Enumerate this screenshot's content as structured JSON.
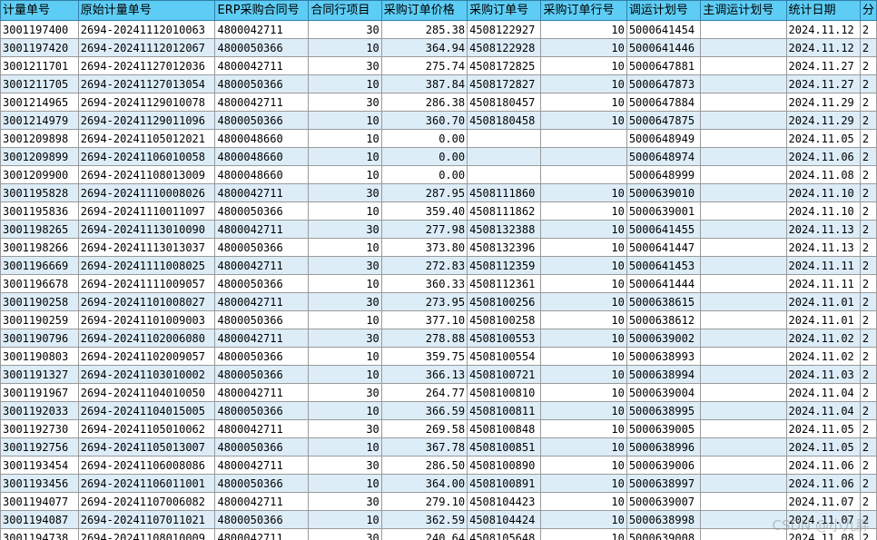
{
  "table": {
    "columns": [
      "计量单号",
      "原始计量单号",
      "ERP采购合同号",
      "合同行项目",
      "采购订单价格",
      "采购订单号",
      "采购订单行号",
      "调运计划号",
      "主调运计划号",
      "统计日期",
      "分"
    ],
    "rows": [
      [
        "3001197400",
        "2694-20241112010063",
        "4800042711",
        "30",
        "285.38",
        "4508122927",
        "10",
        "5000641454",
        "",
        "2024.11.12",
        "2"
      ],
      [
        "3001197420",
        "2694-20241112012067",
        "4800050366",
        "10",
        "364.94",
        "4508122928",
        "10",
        "5000641446",
        "",
        "2024.11.12",
        "2"
      ],
      [
        "3001211701",
        "2694-20241127012036",
        "4800042711",
        "30",
        "275.74",
        "4508172825",
        "10",
        "5000647881",
        "",
        "2024.11.27",
        "2"
      ],
      [
        "3001211705",
        "2694-20241127013054",
        "4800050366",
        "10",
        "387.84",
        "4508172827",
        "10",
        "5000647873",
        "",
        "2024.11.27",
        "2"
      ],
      [
        "3001214965",
        "2694-20241129010078",
        "4800042711",
        "30",
        "286.38",
        "4508180457",
        "10",
        "5000647884",
        "",
        "2024.11.29",
        "2"
      ],
      [
        "3001214979",
        "2694-20241129011096",
        "4800050366",
        "10",
        "360.70",
        "4508180458",
        "10",
        "5000647875",
        "",
        "2024.11.29",
        "2"
      ],
      [
        "3001209898",
        "2694-20241105012021",
        "4800048660",
        "10",
        "0.00",
        "",
        "",
        "5000648949",
        "",
        "2024.11.05",
        "2"
      ],
      [
        "3001209899",
        "2694-20241106010058",
        "4800048660",
        "10",
        "0.00",
        "",
        "",
        "5000648974",
        "",
        "2024.11.06",
        "2"
      ],
      [
        "3001209900",
        "2694-20241108013009",
        "4800048660",
        "10",
        "0.00",
        "",
        "",
        "5000648999",
        "",
        "2024.11.08",
        "2"
      ],
      [
        "3001195828",
        "2694-20241110008026",
        "4800042711",
        "30",
        "287.95",
        "4508111860",
        "10",
        "5000639010",
        "",
        "2024.11.10",
        "2"
      ],
      [
        "3001195836",
        "2694-20241110011097",
        "4800050366",
        "10",
        "359.40",
        "4508111862",
        "10",
        "5000639001",
        "",
        "2024.11.10",
        "2"
      ],
      [
        "3001198265",
        "2694-20241113010090",
        "4800042711",
        "30",
        "277.98",
        "4508132388",
        "10",
        "5000641455",
        "",
        "2024.11.13",
        "2"
      ],
      [
        "3001198266",
        "2694-20241113013037",
        "4800050366",
        "10",
        "373.80",
        "4508132396",
        "10",
        "5000641447",
        "",
        "2024.11.13",
        "2"
      ],
      [
        "3001196669",
        "2694-20241111008025",
        "4800042711",
        "30",
        "272.83",
        "4508112359",
        "10",
        "5000641453",
        "",
        "2024.11.11",
        "2"
      ],
      [
        "3001196678",
        "2694-20241111009057",
        "4800050366",
        "10",
        "360.33",
        "4508112361",
        "10",
        "5000641444",
        "",
        "2024.11.11",
        "2"
      ],
      [
        "3001190258",
        "2694-20241101008027",
        "4800042711",
        "30",
        "273.95",
        "4508100256",
        "10",
        "5000638615",
        "",
        "2024.11.01",
        "2"
      ],
      [
        "3001190259",
        "2694-20241101009003",
        "4800050366",
        "10",
        "377.10",
        "4508100258",
        "10",
        "5000638612",
        "",
        "2024.11.01",
        "2"
      ],
      [
        "3001190796",
        "2694-20241102006080",
        "4800042711",
        "30",
        "278.88",
        "4508100553",
        "10",
        "5000639002",
        "",
        "2024.11.02",
        "2"
      ],
      [
        "3001190803",
        "2694-20241102009057",
        "4800050366",
        "10",
        "359.75",
        "4508100554",
        "10",
        "5000638993",
        "",
        "2024.11.02",
        "2"
      ],
      [
        "3001191327",
        "2694-20241103010002",
        "4800050366",
        "10",
        "366.13",
        "4508100721",
        "10",
        "5000638994",
        "",
        "2024.11.03",
        "2"
      ],
      [
        "3001191967",
        "2694-20241104010050",
        "4800042711",
        "30",
        "264.77",
        "4508100810",
        "10",
        "5000639004",
        "",
        "2024.11.04",
        "2"
      ],
      [
        "3001192033",
        "2694-20241104015005",
        "4800050366",
        "10",
        "366.59",
        "4508100811",
        "10",
        "5000638995",
        "",
        "2024.11.04",
        "2"
      ],
      [
        "3001192730",
        "2694-20241105010062",
        "4800042711",
        "30",
        "269.58",
        "4508100848",
        "10",
        "5000639005",
        "",
        "2024.11.05",
        "2"
      ],
      [
        "3001192756",
        "2694-20241105013007",
        "4800050366",
        "10",
        "367.78",
        "4508100851",
        "10",
        "5000638996",
        "",
        "2024.11.05",
        "2"
      ],
      [
        "3001193454",
        "2694-20241106008086",
        "4800042711",
        "30",
        "286.50",
        "4508100890",
        "10",
        "5000639006",
        "",
        "2024.11.06",
        "2"
      ],
      [
        "3001193456",
        "2694-20241106011001",
        "4800050366",
        "10",
        "364.00",
        "4508100891",
        "10",
        "5000638997",
        "",
        "2024.11.06",
        "2"
      ],
      [
        "3001194077",
        "2694-20241107006082",
        "4800042711",
        "30",
        "279.10",
        "4508104423",
        "10",
        "5000639007",
        "",
        "2024.11.07",
        "2"
      ],
      [
        "3001194087",
        "2694-20241107011021",
        "4800050366",
        "10",
        "362.59",
        "4508104424",
        "10",
        "5000638998",
        "",
        "2024.11.07",
        "2"
      ],
      [
        "3001194738",
        "2694-20241108010009",
        "4800042711",
        "30",
        "240.64",
        "4508105648",
        "10",
        "5000639008",
        "",
        "2024.11.08",
        "2"
      ]
    ]
  },
  "watermark": "CSDN @小九胖",
  "colors": {
    "header_bg": "#5ecdf5",
    "row_alt_bg": "#dcedf8",
    "grid_line": "#9a9a9a"
  }
}
